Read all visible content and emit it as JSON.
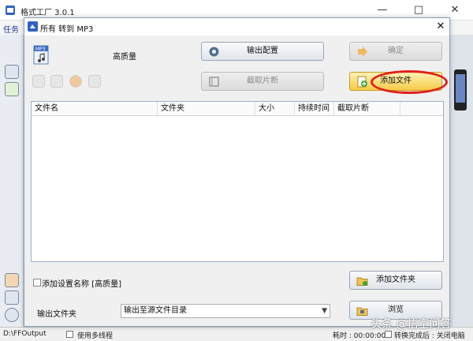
{
  "window": {
    "title": "格式工厂 3.0.1",
    "minimize": "—",
    "maximize": "□",
    "close": "✕"
  },
  "menubar": {
    "first_item": "任务"
  },
  "dialog": {
    "title": "所有 转到 MP3",
    "close": "✕",
    "quality_label": "高质量",
    "output_config_button": "输出配置",
    "ok_button": "确定",
    "clip_button": "截取片断",
    "add_file_button": "添加文件",
    "add_folder_button": "添加文件夹",
    "browse_button": "浏览",
    "columns": [
      "文件名",
      "文件夹",
      "大小",
      "持续时间",
      "截取片断"
    ],
    "rows": [],
    "add_setting_label": "添加设置名称 [高质量]",
    "add_setting_checked": false,
    "output_folder_label": "输出文件夹",
    "output_folder_value": "输出至源文件目录",
    "ok_disabled": true,
    "clip_disabled": true
  },
  "statusbar": {
    "output_path": "D:\\FFOutput",
    "multithread_label": "使用多线程",
    "elapsed": "耗时 : 00:00:00",
    "after_convert": "转换完成后 : 关闭电脑"
  },
  "watermark": "头条 @悟空问答",
  "colors": {
    "accent_gold": "#f6cb48",
    "annotation_red": "#e0201a",
    "dialog_border": "#8aa0c0"
  },
  "icons": [
    "app-icon",
    "mp3-file-icon",
    "gear-icon",
    "film-icon",
    "add-file-icon",
    "add-folder-icon",
    "browse-icon",
    "music-icon",
    "image-icon"
  ]
}
